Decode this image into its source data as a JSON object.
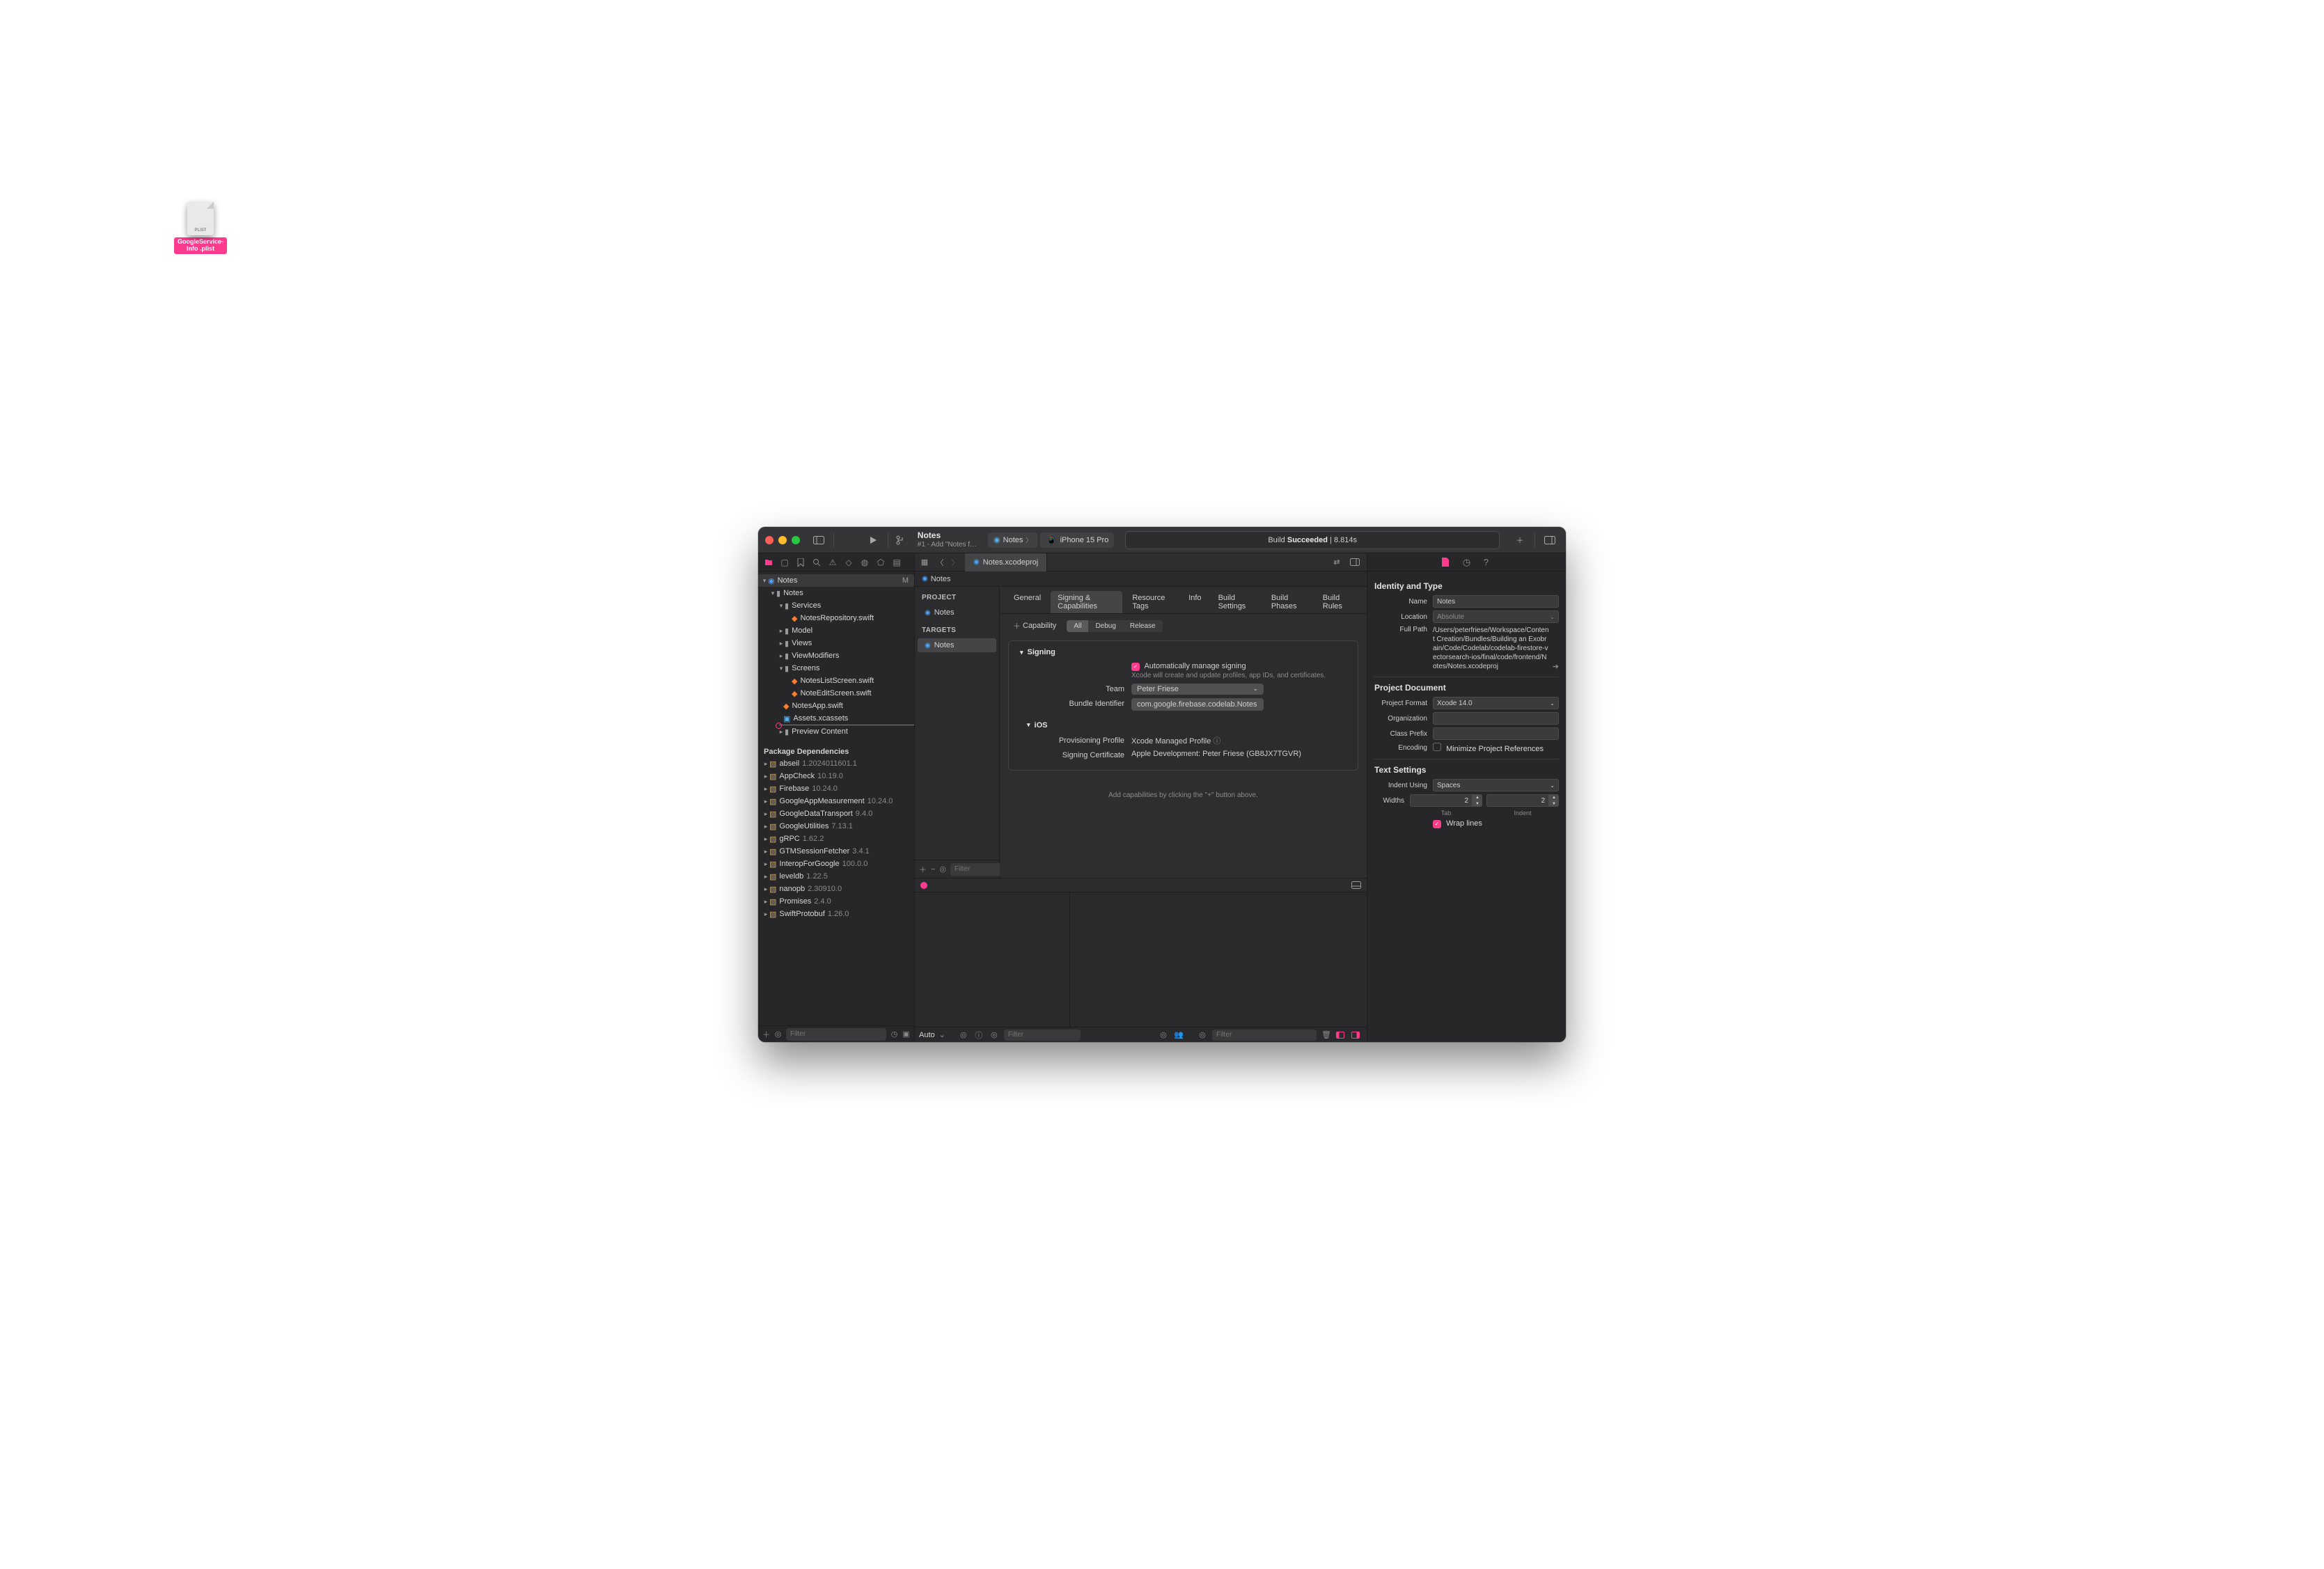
{
  "toolbar": {
    "scheme_title": "Notes",
    "scheme_subtitle": "#1 - Add \"Notes f…",
    "scheme_target": "Notes",
    "device": "iPhone 15 Pro",
    "status_prefix": "Build ",
    "status_bold": "Succeeded",
    "status_suffix": " | 8.814s"
  },
  "tab": {
    "file": "Notes.xcodeproj"
  },
  "crumb": {
    "item": "Notes"
  },
  "drag": {
    "ext": "PLIST",
    "label_line1": "GoogleService-",
    "label_line2": "Info .plist"
  },
  "tree": {
    "root": {
      "name": "Notes",
      "status": "M"
    },
    "l1": [
      {
        "name": "Notes",
        "type": "folder",
        "open": true,
        "indent": 1
      }
    ],
    "services": {
      "name": "Services"
    },
    "services_children": [
      {
        "name": "NotesRepository.swift",
        "type": "swift"
      }
    ],
    "folders": [
      {
        "name": "Model",
        "open": false
      },
      {
        "name": "Views",
        "open": false
      },
      {
        "name": "ViewModifiers",
        "open": false
      }
    ],
    "screens": {
      "name": "Screens"
    },
    "screens_children": [
      {
        "name": "NotesListScreen.swift",
        "type": "swift"
      },
      {
        "name": "NoteEditScreen.swift",
        "type": "swift"
      }
    ],
    "root_files": [
      {
        "name": "NotesApp.swift",
        "type": "swift"
      },
      {
        "name": "Assets.xcassets",
        "type": "asset",
        "highlight": true
      },
      {
        "name": "Preview Content",
        "type": "folder"
      }
    ],
    "pkg_header": "Package Dependencies",
    "packages": [
      {
        "name": "abseil",
        "ver": "1.2024011601.1"
      },
      {
        "name": "AppCheck",
        "ver": "10.19.0"
      },
      {
        "name": "Firebase",
        "ver": "10.24.0"
      },
      {
        "name": "GoogleAppMeasurement",
        "ver": "10.24.0"
      },
      {
        "name": "GoogleDataTransport",
        "ver": "9.4.0"
      },
      {
        "name": "GoogleUtilities",
        "ver": "7.13.1"
      },
      {
        "name": "gRPC",
        "ver": "1.62.2"
      },
      {
        "name": "GTMSessionFetcher",
        "ver": "3.4.1"
      },
      {
        "name": "InteropForGoogle",
        "ver": "100.0.0"
      },
      {
        "name": "leveldb",
        "ver": "1.22.5"
      },
      {
        "name": "nanopb",
        "ver": "2.30910.0"
      },
      {
        "name": "Promises",
        "ver": "2.4.0"
      },
      {
        "name": "SwiftProtobuf",
        "ver": "1.26.0"
      }
    ]
  },
  "nav_filter_placeholder": "Filter",
  "proj_sidebar": {
    "project_head": "PROJECT",
    "project_item": "Notes",
    "targets_head": "TARGETS",
    "target_item": "Notes"
  },
  "proj_tabs": [
    "General",
    "Signing & Capabilities",
    "Resource Tags",
    "Info",
    "Build Settings",
    "Build Phases",
    "Build Rules"
  ],
  "proj_tabs_active": 1,
  "cap": {
    "add": "Capability",
    "seg": [
      "All",
      "Debug",
      "Release"
    ],
    "seg_active": 0
  },
  "signing": {
    "head": "Signing",
    "auto_label": "Automatically manage signing",
    "auto_sub": "Xcode will create and update profiles, app IDs, and certificates.",
    "team_label": "Team",
    "team_val": "Peter Friese",
    "bundle_label": "Bundle Identifier",
    "bundle_val": "com.google.firebase.codelab.Notes",
    "ios_head": "iOS",
    "prov_label": "Provisioning Profile",
    "prov_val": "Xcode Managed Profile",
    "cert_label": "Signing Certificate",
    "cert_val": "Apple Development: Peter Friese (GB8JX7TGVR)",
    "hint": "Add capabilities by clicking the \"+\" button above."
  },
  "filter_placeholder": "Filter",
  "debug": {
    "auto": "Auto"
  },
  "inspector": {
    "identity_head": "Identity and Type",
    "name_label": "Name",
    "name_val": "Notes",
    "location_label": "Location",
    "location_val": "Absolute",
    "full_path_label": "Full Path",
    "full_path_val": "/Users/peterfriese/Workspace/Content Creation/Bundles/Building an Exobrain/Code/Codelab/codelab-firestore-vectorsearch-ios/final/code/frontend/Notes/Notes.xcodeproj",
    "projdoc_head": "Project Document",
    "format_label": "Project Format",
    "format_val": "Xcode 14.0",
    "org_label": "Organization",
    "prefix_label": "Class Prefix",
    "encoding_label": "Encoding",
    "encoding_val": "Minimize Project References",
    "text_head": "Text Settings",
    "indent_label": "Indent Using",
    "indent_val": "Spaces",
    "widths_label": "Widths",
    "width_tab": "2",
    "width_indent": "2",
    "width_tab_lbl": "Tab",
    "width_indent_lbl": "Indent",
    "wrap_label": "Wrap lines"
  }
}
